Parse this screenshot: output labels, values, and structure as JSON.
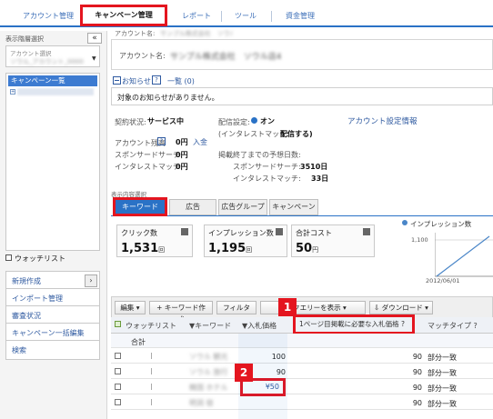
{
  "nav": {
    "tabs": [
      {
        "label": "アカウント管理"
      },
      {
        "label": "キャンペーン管理"
      },
      {
        "label": "レポート"
      },
      {
        "label": "ツール"
      },
      {
        "label": "資金管理"
      }
    ]
  },
  "sidebar": {
    "title": "表示階層選択",
    "collapse": "«",
    "account_select_label": "アカウント選択",
    "account_select_value": "ソウル_アカウント_0000",
    "tree_root": "キャンペーン一覧",
    "watchlist": "ウォッチリスト",
    "menu": [
      {
        "label": "新規作成"
      },
      {
        "label": "インポート管理"
      },
      {
        "label": "審査状況"
      },
      {
        "label": "キャンペーン一括編集"
      },
      {
        "label": "検索"
      }
    ]
  },
  "account": {
    "name_label_top": "アカウント名:",
    "name_label": "アカウント名:",
    "name_value": "サンプル株式会社　ソウル店4"
  },
  "notice": {
    "title": "お知らせ",
    "list_link": "一覧 (0)",
    "empty": "対象のお知らせがありません。"
  },
  "status": {
    "contract_label": "契約状況:",
    "contract_value": "サービス中",
    "delivery_label": "配信設定:",
    "delivery_value": "オン",
    "interest_label": "(インタレストマッチ:",
    "interest_value": "配信する)",
    "settings_link": "アカウント設定情報",
    "balance_label": "アカウント残高",
    "balance_value": "0円",
    "deposit_link": "入金",
    "sponsored_label": "スポンサードサーチ:",
    "sponsored_value": "0円",
    "interest_match_label": "インタレストマッチ:",
    "interest_match_value": "0円",
    "forecast_label": "掲載終了までの予想日数:",
    "forecast_sponsored_label": "スポンサードサーチ:",
    "forecast_sponsored_value": "3510日",
    "forecast_interest_label": "インタレストマッチ:",
    "forecast_interest_value": "33日"
  },
  "content_tabs": {
    "label": "表示内容選択",
    "tabs": [
      {
        "label": "キーワード"
      },
      {
        "label": "広告"
      },
      {
        "label": "広告グループ"
      },
      {
        "label": "キャンペーン"
      }
    ]
  },
  "stats": [
    {
      "label": "クリック数",
      "value": "1,531",
      "unit": "回"
    },
    {
      "label": "インプレッション数",
      "value": "1,195",
      "unit": "回"
    },
    {
      "label": "合計コスト",
      "value": "50",
      "unit": "円"
    }
  ],
  "mini_chart": {
    "legend": "インプレッション数",
    "ytick": "1,100",
    "xtick": "2012/06/01"
  },
  "toolbar": {
    "edit": "編集",
    "create_keyword": "キーワード作成",
    "filter": "フィルター",
    "search_query": "検索クエリーを表示",
    "download": "ダウンロード"
  },
  "table": {
    "headers": {
      "watchlist": "ウォッチリスト",
      "keyword": "キーワード",
      "bid": "入札価格",
      "page1_bid": "1ページ目掲載に必要な入札価格",
      "match": "マッチタイプ"
    },
    "total_label": "合計",
    "rows": [
      {
        "keyword": "ソウル 観光",
        "bid": "100",
        "page1": "90",
        "match": "部分一致"
      },
      {
        "keyword": "ソウル 旅行",
        "bid": "90",
        "page1": "90",
        "match": "部分一致"
      },
      {
        "keyword": "韓国 ホテル",
        "bid": "¥50",
        "page1": "90",
        "match": "部分一致"
      },
      {
        "keyword": "明洞 宿",
        "bid": "",
        "page1": "90",
        "match": "部分一致"
      }
    ]
  },
  "callouts": {
    "one": "1",
    "two": "2"
  },
  "colors": {
    "accent": "#2a72c6",
    "highlight": "#e4151f"
  }
}
